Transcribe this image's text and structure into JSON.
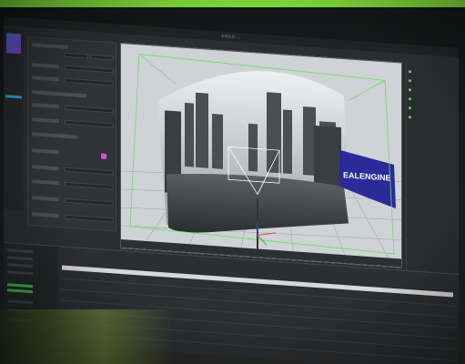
{
  "window": {
    "title": "CYCLO ..."
  },
  "viewport": {
    "banner_text": "EALENGINE"
  },
  "outliner": {
    "items": [
      "",
      "",
      "",
      "",
      "",
      ""
    ]
  },
  "colors": {
    "accent_green": "#7ed63a",
    "selection_green": "#5ad05a",
    "pink_swatch": "#e04ad8",
    "banner_blue": "#2a2a9a"
  },
  "icons": [
    "thumbnail-icon",
    "pink-swatch-icon",
    "gizmo-icon"
  ]
}
